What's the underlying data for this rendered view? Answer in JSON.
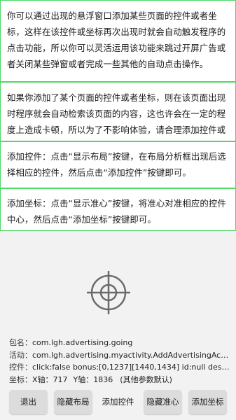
{
  "paragraphs": [
    "你可以通过出现的悬浮窗口添加某些页面的控件或者坐标，这样在该控件或坐标再次出现时就会自动触发程序的点击功能，所以你可以灵活运用该功能来跳过开屏广告或者关闭某些弹窗或者完成一些其他的自动点击操作。",
    "如果你添加了某个页面的控件或者坐标，则在该页面出现时程序就会自动检索该页面的内容，这也许会在一定的程度上造成卡顿，所以为了不影响体验，请合理添加控件或坐标.",
    "添加控件：点击“显示布局”按键，在布局分析框出现后选择相应的控件，然后点击“添加控件”按键即可。",
    "添加坐标：点击“显示准心”按键，将准心对准相应的控件中心，然后点击“添加坐标”按键即可。"
  ],
  "info": {
    "package_label": "包名：",
    "package_value": "com.lgh.advertising.going",
    "activity_label": "活动：",
    "activity_value": "com.lgh.advertising.myactivity.AddAdvertisingActivity",
    "widget_label": "控件：",
    "widget_value": "click:false bonus:[0,1237][1440,1434] id:null desc:null text:...",
    "coord_label": "坐标：",
    "coord_x_label": "X轴：",
    "coord_x_value": "717",
    "coord_y_label": "Y轴：",
    "coord_y_value": "1836",
    "coord_note": "(其他参数默认)"
  },
  "buttons": {
    "exit": "退出",
    "hide_layout": "隐藏布局",
    "add_widget": "添加控件",
    "hide_crosshair": "隐藏准心",
    "add_coord": "添加坐标"
  },
  "colors": {
    "box_border": "#4cd964",
    "button_bg": "#dcdcdc",
    "crosshair": "#6b6b6b"
  },
  "icons": {
    "crosshair": "crosshair-icon"
  }
}
